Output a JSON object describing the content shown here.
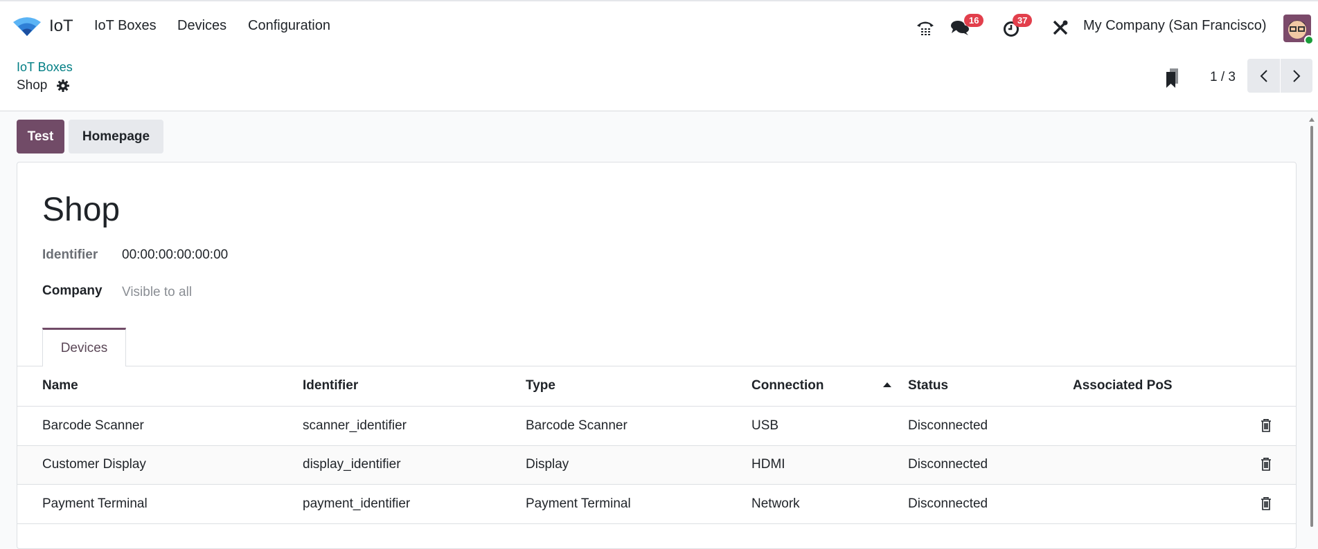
{
  "navbar": {
    "app_name": "IoT",
    "menu": [
      "IoT Boxes",
      "Devices",
      "Configuration"
    ],
    "messages_count": "16",
    "activities_count": "37",
    "company": "My Company (San Francisco)"
  },
  "control": {
    "breadcrumb_parent": "IoT Boxes",
    "breadcrumb_current": "Shop",
    "pager": "1 / 3"
  },
  "buttons": {
    "test": "Test",
    "homepage": "Homepage"
  },
  "form": {
    "title": "Shop",
    "identifier_label": "Identifier",
    "identifier_value": "00:00:00:00:00:00",
    "company_label": "Company",
    "company_placeholder": "Visible to all"
  },
  "tabs": [
    "Devices"
  ],
  "table": {
    "headers": [
      "Name",
      "Identifier",
      "Type",
      "Connection",
      "Status",
      "Associated PoS"
    ],
    "rows": [
      [
        "Barcode Scanner",
        "scanner_identifier",
        "Barcode Scanner",
        "USB",
        "Disconnected",
        ""
      ],
      [
        "Customer Display",
        "display_identifier",
        "Display",
        "HDMI",
        "Disconnected",
        ""
      ],
      [
        "Payment Terminal",
        "payment_identifier",
        "Payment Terminal",
        "Network",
        "Disconnected",
        ""
      ]
    ]
  },
  "colors": {
    "brand": "#714B67",
    "link": "#017e84",
    "badge": "#e23f4c"
  }
}
